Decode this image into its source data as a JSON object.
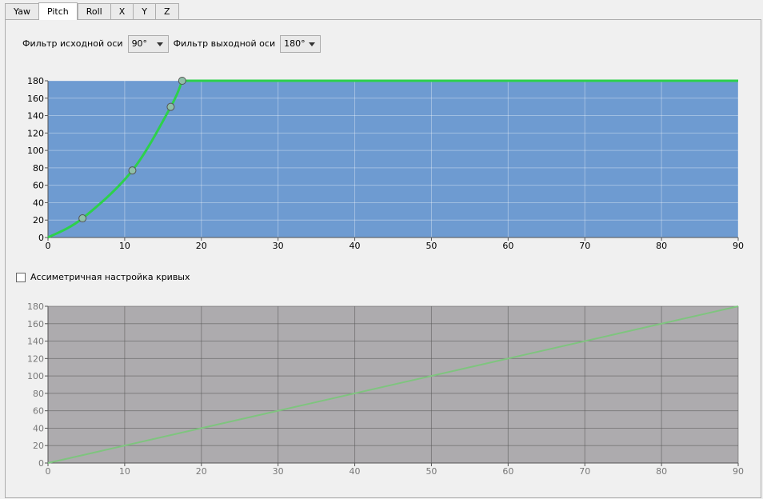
{
  "tabs": [
    {
      "label": "Yaw",
      "active": false
    },
    {
      "label": "Pitch",
      "active": true
    },
    {
      "label": "Roll",
      "active": false
    },
    {
      "label": "X",
      "active": false
    },
    {
      "label": "Y",
      "active": false
    },
    {
      "label": "Z",
      "active": false
    }
  ],
  "filters": {
    "source_label": "Фильтр исходной оси",
    "source_value": "90°",
    "output_label": "Фильтр выходной оси",
    "output_value": "180°"
  },
  "asymmetric": {
    "label": "Ассиметричная настройка кривых",
    "checked": false
  },
  "colors": {
    "top_bg": "#6e9bd1",
    "top_curve": "#2dd14b",
    "bottom_bg": "#adabae",
    "bottom_line": "#7fc47f",
    "point_fill": "#8fbfa8"
  },
  "chart_data": [
    {
      "type": "line",
      "xlim": [
        0,
        90
      ],
      "ylim": [
        0,
        180
      ],
      "x_ticks": [
        "0",
        "10",
        "20",
        "30",
        "40",
        "50",
        "60",
        "70",
        "80",
        "90"
      ],
      "y_ticks": [
        "0",
        "20",
        "40",
        "60",
        "80",
        "100",
        "120",
        "140",
        "160",
        "180"
      ],
      "control_points": [
        [
          0,
          0
        ],
        [
          4.5,
          22
        ],
        [
          11,
          77
        ],
        [
          16,
          150
        ],
        [
          17.5,
          180
        ]
      ],
      "series": [
        {
          "x": [
            0,
            4.5,
            11,
            16,
            17.5,
            90
          ],
          "y": [
            0,
            22,
            77,
            150,
            180,
            180
          ]
        }
      ],
      "grid": true
    },
    {
      "type": "line",
      "xlim": [
        0,
        90
      ],
      "ylim": [
        0,
        180
      ],
      "x_ticks": [
        "0",
        "10",
        "20",
        "30",
        "40",
        "50",
        "60",
        "70",
        "80",
        "90"
      ],
      "y_ticks": [
        "0",
        "20",
        "40",
        "60",
        "80",
        "100",
        "120",
        "140",
        "160",
        "180"
      ],
      "series": [
        {
          "x": [
            0,
            90
          ],
          "y": [
            0,
            180
          ]
        }
      ],
      "grid": true
    }
  ]
}
